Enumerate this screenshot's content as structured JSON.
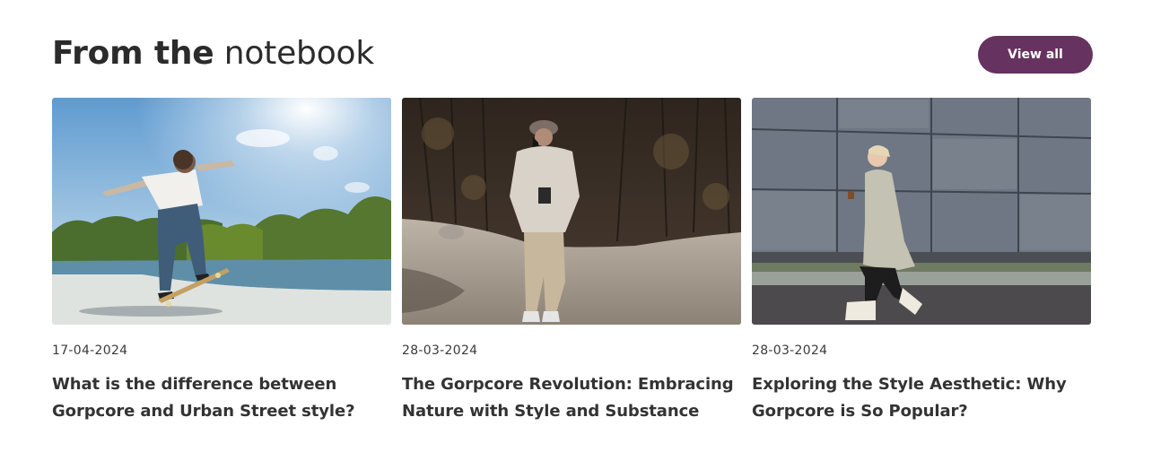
{
  "header": {
    "title_bold": "From the",
    "title_regular": "notebook",
    "view_all_label": "View all"
  },
  "colors": {
    "accent": "#66325f",
    "text": "#2b2b2b"
  },
  "posts": [
    {
      "date": "17-04-2024",
      "title": "What is the difference between Gorpcore and Urban Street style?",
      "image": "skateboarder-photo"
    },
    {
      "date": "28-03-2024",
      "title": "The Gorpcore Revolution: Embracing Nature with Style and Substance",
      "image": "forest-hiker-photo"
    },
    {
      "date": "28-03-2024",
      "title": "Exploring the Style Aesthetic: Why Gorpcore is So Popular?",
      "image": "street-walker-photo"
    }
  ]
}
